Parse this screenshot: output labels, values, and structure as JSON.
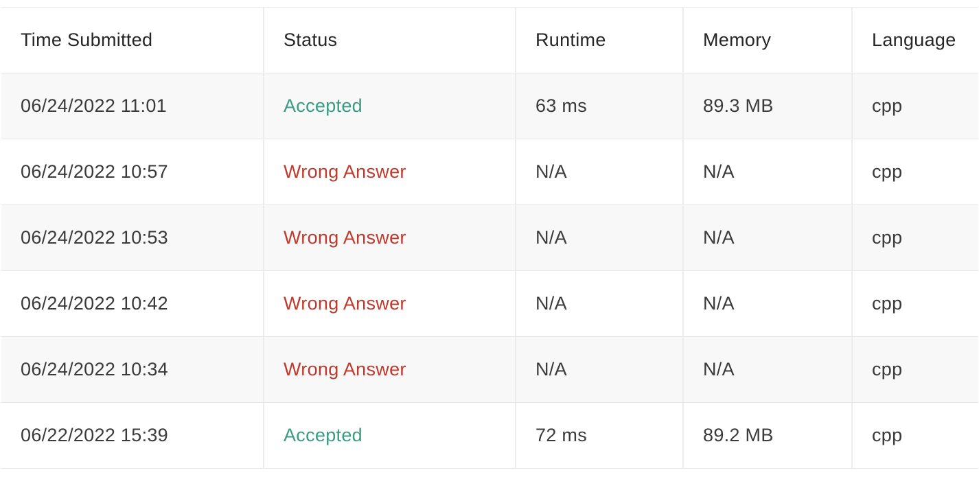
{
  "table": {
    "headers": {
      "time": "Time Submitted",
      "status": "Status",
      "runtime": "Runtime",
      "memory": "Memory",
      "language": "Language"
    },
    "rows": [
      {
        "time": "06/24/2022 11:01",
        "status": "Accepted",
        "runtime": "63 ms",
        "memory": "89.3 MB",
        "language": "cpp"
      },
      {
        "time": "06/24/2022 10:57",
        "status": "Wrong Answer",
        "runtime": "N/A",
        "memory": "N/A",
        "language": "cpp"
      },
      {
        "time": "06/24/2022 10:53",
        "status": "Wrong Answer",
        "runtime": "N/A",
        "memory": "N/A",
        "language": "cpp"
      },
      {
        "time": "06/24/2022 10:42",
        "status": "Wrong Answer",
        "runtime": "N/A",
        "memory": "N/A",
        "language": "cpp"
      },
      {
        "time": "06/24/2022 10:34",
        "status": "Wrong Answer",
        "runtime": "N/A",
        "memory": "N/A",
        "language": "cpp"
      },
      {
        "time": "06/22/2022 15:39",
        "status": "Accepted",
        "runtime": "72 ms",
        "memory": "89.2 MB",
        "language": "cpp"
      }
    ]
  },
  "colors": {
    "accepted": "#3a9c82",
    "wrong_answer": "#c0392b",
    "striped_row": "#f8f8f8"
  }
}
